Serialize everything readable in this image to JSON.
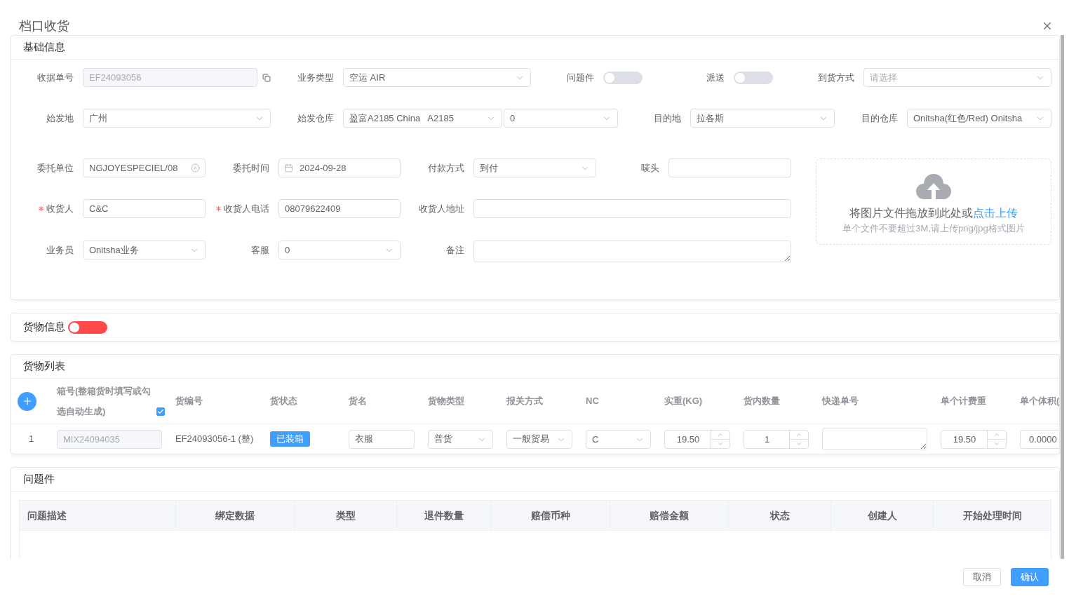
{
  "dialog": {
    "title": "档口收货"
  },
  "basic_info": {
    "title": "基础信息",
    "rows": [
      [
        {
          "label": "收据单号",
          "kind": "copytext",
          "value": "EF24093056",
          "disabled": true
        },
        {
          "label": "业务类型",
          "kind": "select",
          "value": "空运 AIR"
        },
        {
          "label": "问题件",
          "kind": "switch",
          "on": false
        },
        {
          "label": "派送",
          "kind": "switch",
          "on": false
        },
        {
          "label": "到货方式",
          "kind": "select",
          "placeholder": "请选择"
        }
      ],
      [
        {
          "label": "始发地",
          "kind": "select",
          "value": "广州"
        },
        {
          "label": "始发仓库",
          "kind": "selectpair",
          "values": [
            "盈富A2185 China   A2185",
            "0"
          ]
        },
        {
          "label": "目的地",
          "kind": "select",
          "value": "拉各斯"
        },
        {
          "label": "目的仓库",
          "kind": "select",
          "value": "Onitsha(红色/Red) Onitsha"
        }
      ],
      [
        {
          "label": "委托单位",
          "kind": "cleartext",
          "value": "NGJOYESPECIEL/08"
        },
        {
          "label": "委托时间",
          "kind": "date",
          "value": "2024-09-28"
        },
        {
          "label": "付款方式",
          "kind": "select",
          "value": "到付"
        },
        {
          "label": "唛头",
          "kind": "text"
        }
      ],
      [
        {
          "label": "收货人",
          "kind": "text",
          "value": "C&C",
          "required": true
        },
        {
          "label": "收货人电话",
          "kind": "text",
          "value": "08079622409",
          "required": true
        },
        {
          "label": "收货人地址",
          "kind": "text"
        }
      ],
      [
        {
          "label": "业务员",
          "kind": "select",
          "value": "Onitsha业务"
        },
        {
          "label": "客服",
          "kind": "select",
          "value": "0"
        },
        {
          "label": "备注",
          "kind": "textarea"
        }
      ]
    ],
    "upload": {
      "prompt": "将图片文件拖放到此处或",
      "link": "点击上传",
      "hint": "单个文件不要超过3M,请上传png/jpg格式图片"
    }
  },
  "cargo_info": {
    "title": "货物信息",
    "on": false
  },
  "cargo_list": {
    "title": "货物列表",
    "auto_generate": {
      "checked": true
    },
    "columns": [
      "",
      "箱号(整箱货时填写或勾选自动生成)",
      "货编号",
      "货状态",
      "货名",
      "货物类型",
      "报关方式",
      "NC",
      "实重(KG)",
      "货内数量",
      "快递单号",
      "单个计费重",
      "单个体积("
    ],
    "rows": [
      {
        "cells": [
          {
            "kind": "index",
            "value": "1"
          },
          {
            "kind": "input",
            "value": "MIX24094035",
            "disabled": true
          },
          {
            "kind": "text",
            "value": "EF24093056-1 (整)"
          },
          {
            "kind": "tag",
            "value": "已装箱"
          },
          {
            "kind": "input",
            "value": "衣服"
          },
          {
            "kind": "select",
            "value": "普货"
          },
          {
            "kind": "select",
            "value": "一般贸易"
          },
          {
            "kind": "select",
            "value": "C"
          },
          {
            "kind": "number",
            "value": "19.50"
          },
          {
            "kind": "number",
            "value": "1"
          },
          {
            "kind": "textarea"
          },
          {
            "kind": "number",
            "value": "19.50"
          },
          {
            "kind": "input",
            "value": "0.0000"
          }
        ]
      }
    ]
  },
  "issues": {
    "title": "问题件",
    "columns": [
      "问题描述",
      "绑定数据",
      "类型",
      "退件数量",
      "赔偿币种",
      "赔偿金额",
      "状态",
      "创建人",
      "开始处理时间"
    ]
  },
  "footer": {
    "buttons": [
      {
        "label": "取消",
        "kind": "secondary"
      },
      {
        "label": "确认",
        "kind": "primary"
      }
    ]
  }
}
